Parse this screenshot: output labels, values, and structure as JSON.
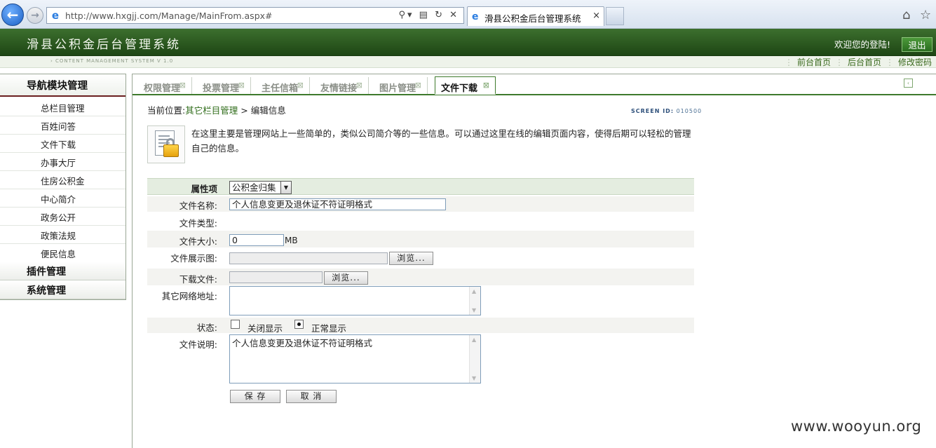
{
  "browser": {
    "url": "http://www.hxgjj.com/Manage/MainFrom.aspx#",
    "tab_title": "滑县公积金后台管理系统",
    "tab_close": "×"
  },
  "header": {
    "title": "滑县公积金后台管理系统",
    "welcome": "欢迎您的登陆!",
    "logout": "退出",
    "cms_caption": "› CONTENT MANAGEMENT SYSTEM V 1.0",
    "links": [
      "前台首页",
      "后台首页",
      "修改密码"
    ]
  },
  "sidebar": {
    "title": "导航模块管理",
    "items": [
      "总栏目管理",
      "百姓问答",
      "文件下载",
      "办事大厅",
      "住房公积金",
      "中心简介",
      "政务公开",
      "政策法规",
      "便民信息"
    ],
    "groups": [
      "插件管理",
      "系统管理"
    ]
  },
  "tabs": [
    "权限管理",
    "投票管理",
    "主任信箱",
    "友情链接",
    "图片管理",
    "文件下载"
  ],
  "tab_close": "⊠",
  "breadcrumb": {
    "prefix": "当前位置:",
    "link": "其它栏目管理",
    "sep": ">",
    "current": "编辑信息"
  },
  "screen_id": {
    "label": "SCREEN ID:",
    "value": "010500"
  },
  "info_text": "在这里主要是管理网站上一些简单的，类似公司简介等的一些信息。可以通过这里在线的编辑页面内容，使得后期可以轻松的管理自己的信息。",
  "form": {
    "attr_label": "属性项",
    "attr_value": "公积金归集",
    "name_label": "文件名称:",
    "name_value": "个人信息变更及退休证不符证明格式",
    "type_label": "文件类型:",
    "size_label": "文件大小:",
    "size_value": "0",
    "size_unit": "MB",
    "preview_label": "文件展示图:",
    "browse": "浏览...",
    "download_label": "下载文件:",
    "other_url_label": "其它网络地址:",
    "status_label": "状态:",
    "status_off": "关闭显示",
    "status_on": "正常显示",
    "desc_label": "文件说明:",
    "desc_value": "个人信息变更及退休证不符证明格式",
    "save": "保 存",
    "cancel": "取 消"
  },
  "watermark": "www.wooyun.org"
}
